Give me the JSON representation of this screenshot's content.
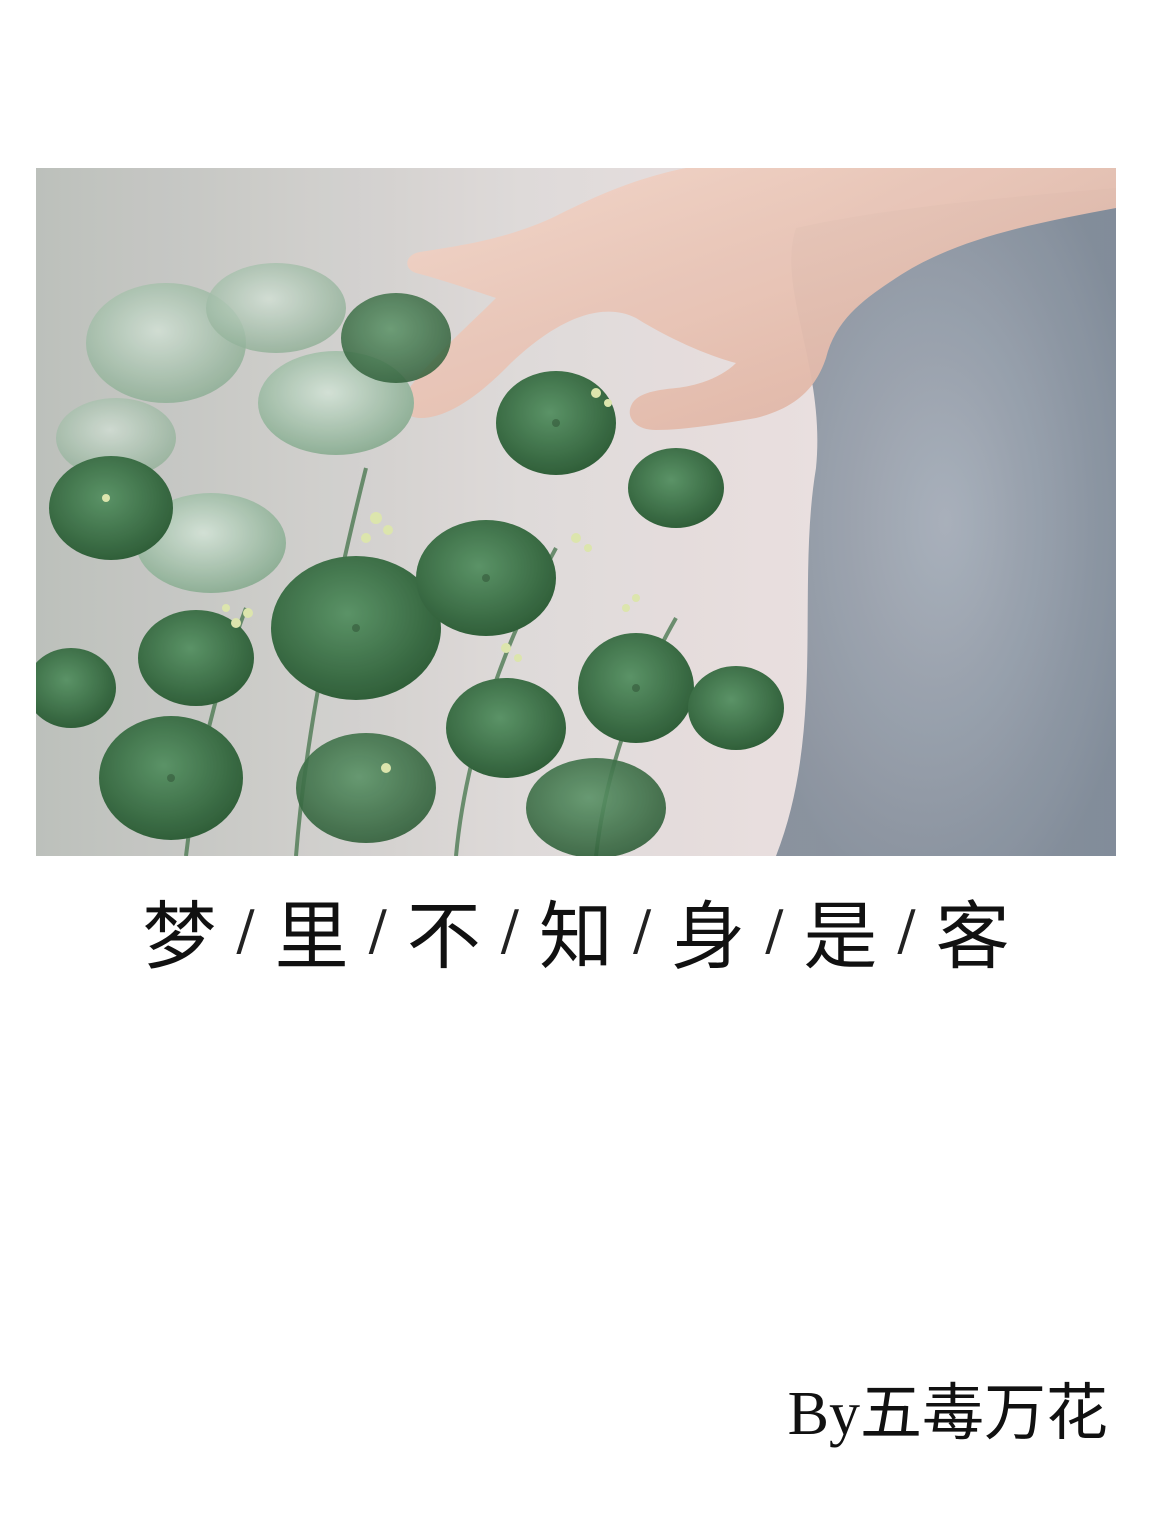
{
  "title_chars": [
    "梦",
    "里",
    "不",
    "知",
    "身",
    "是",
    "客"
  ],
  "title_separator": "/",
  "author": "By五毒万花",
  "colors": {
    "background": "#ffffff",
    "text": "#111111",
    "leaf_dark": "#2f6b3b",
    "leaf_light": "#8fb496",
    "skin": "#e9c4b4",
    "fabric": "#8f9aa8"
  }
}
